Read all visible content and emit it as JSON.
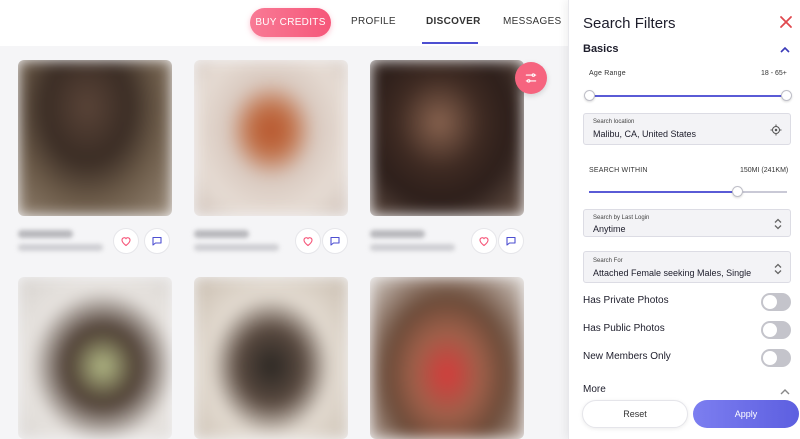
{
  "nav": {
    "buy_credits": "BUY CREDITS",
    "profile": "PROFILE",
    "discover": "DISCOVER",
    "messages": "MESSAGES"
  },
  "colors": {
    "accent_pink": "#f6577a",
    "accent_purple": "#5d5fe0"
  },
  "icons": {
    "filter": "sliders-icon",
    "like": "heart-icon",
    "message": "chat-bubble-icon",
    "close": "close-icon",
    "location": "crosshair-icon"
  },
  "filters": {
    "title": "Search Filters",
    "basics": "Basics",
    "age_range": {
      "label": "Age Range",
      "value": "18 - 65+",
      "min_fraction": 0,
      "max_fraction": 1
    },
    "location": {
      "label": "Search location",
      "value": "Malibu, CA, United States"
    },
    "search_within": {
      "label": "SEARCH WITHIN",
      "value": "150MI (241KM)",
      "fraction": 0.75
    },
    "last_login": {
      "label": "Search by Last Login",
      "value": "Anytime"
    },
    "search_for": {
      "label": "Search For",
      "value": "Attached Female seeking Males, Single"
    },
    "toggles": [
      {
        "label": "Has Private Photos",
        "on": false
      },
      {
        "label": "Has Public Photos",
        "on": false
      },
      {
        "label": "New Members Only",
        "on": false
      }
    ],
    "more": "More",
    "reset": "Reset",
    "apply": "Apply"
  }
}
